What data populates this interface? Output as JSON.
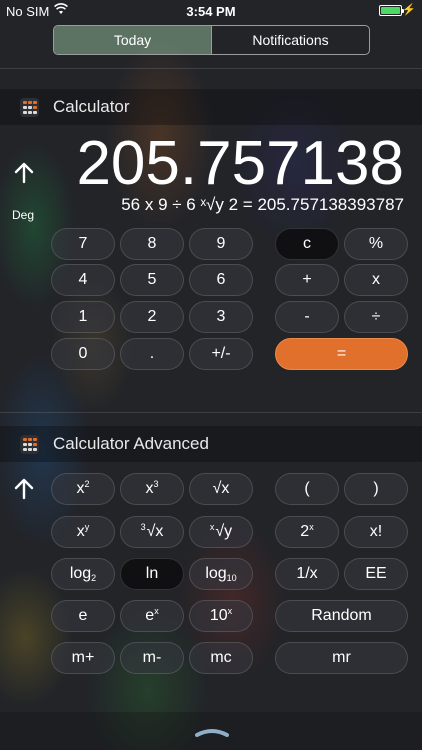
{
  "status_bar": {
    "carrier": "No SIM",
    "time": "3:54 PM",
    "icons": [
      "wifi-icon",
      "battery-icon",
      "charging-bolt-icon"
    ]
  },
  "tabs": [
    {
      "label": "Today",
      "active": true
    },
    {
      "label": "Notifications",
      "active": false
    }
  ],
  "calculator": {
    "title": "Calculator",
    "display": "205.757138",
    "expression": "56 x 9 ÷ 6 ˣ√y 2 = 205.757138393787",
    "mode": "Deg",
    "keys": {
      "seven": "7",
      "eight": "8",
      "nine": "9",
      "four": "4",
      "five": "5",
      "six": "6",
      "one": "1",
      "two": "2",
      "three": "3",
      "zero": "0",
      "dot": ".",
      "plusminus": "+/-",
      "clear": "c",
      "percent": "%",
      "plus": "+",
      "multiply": "x",
      "minus": "-",
      "divide": "÷",
      "equals": "="
    }
  },
  "advanced": {
    "title": "Calculator Advanced",
    "keys": {
      "x_squared": {
        "base": "x",
        "sup": "2"
      },
      "x_cubed": {
        "base": "x",
        "sup": "3"
      },
      "sqrt": "√x",
      "open_paren": "(",
      "close_paren": ")",
      "x_pow_y": {
        "base": "x",
        "sup": "y"
      },
      "cbrt": {
        "pre": "3",
        "base": "√x"
      },
      "yroot": {
        "pre": "x",
        "base": "√y"
      },
      "two_pow_x": {
        "base": "2",
        "sup": "x"
      },
      "factorial": "x!",
      "log2": {
        "base": "log",
        "sub": "2"
      },
      "ln": "ln",
      "log10": {
        "base": "log",
        "sub": "10"
      },
      "reciprocal": "1/x",
      "ee": "EE",
      "e": "e",
      "e_pow_x": {
        "base": "e",
        "sup": "x"
      },
      "ten_pow_x": {
        "base": "10",
        "sup": "x"
      },
      "random": "Random",
      "mplus": "m+",
      "mminus": "m-",
      "mc": "mc",
      "mr": "mr"
    }
  },
  "colors": {
    "accent_orange": "#e0702c",
    "battery_green": "#4cd964"
  }
}
